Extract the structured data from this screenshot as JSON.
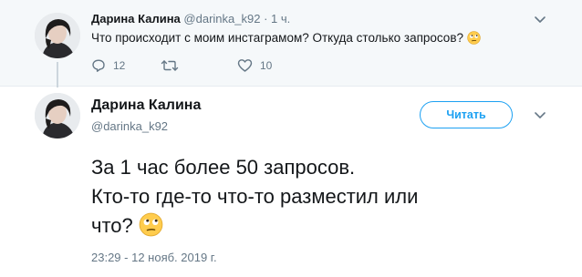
{
  "parent_tweet": {
    "author_name": "Дарина Калина",
    "author_handle": "@darinka_k92",
    "separator": "·",
    "time_ago": "1 ч.",
    "text": "Что происходит с моим инстаграмом? Откуда столько запросов?",
    "emoji": "face-with-rolling-eyes",
    "reply_count": "12",
    "retweet_count": "",
    "like_count": "10",
    "icons": {
      "reply": "reply-icon",
      "retweet": "retweet-icon",
      "like": "heart-icon",
      "menu": "chevron-down-icon"
    }
  },
  "main_tweet": {
    "author_name": "Дарина Калина",
    "author_handle": "@darinka_k92",
    "follow_label": "Читать",
    "text_line1": "За 1 час более 50 запросов.",
    "text_line2": "Кто-то где-то что-то разместил или",
    "text_line3": "что?",
    "emoji": "face-with-rolling-eyes",
    "timestamp": "23:29 - 12 нояб. 2019 г."
  },
  "colors": {
    "accent": "#1da1f2",
    "secondary_text": "#657786",
    "parent_background": "#f5f8fa",
    "thread_line": "#ccd6dd"
  }
}
